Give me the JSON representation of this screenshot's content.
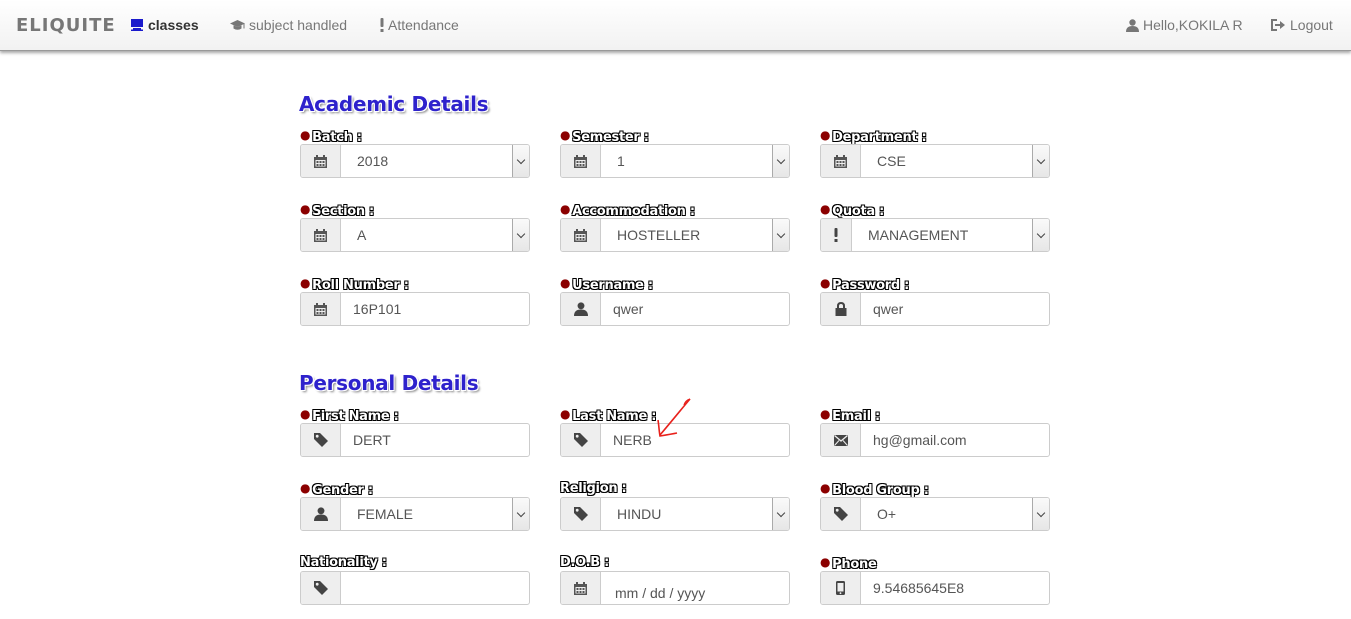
{
  "nav": {
    "brand": "ELIQUITE",
    "items": [
      {
        "label": "classes",
        "icon": "monitor-icon",
        "active": true
      },
      {
        "label": "subject handled",
        "icon": "graduation-cap-icon",
        "active": false
      },
      {
        "label": "Attendance",
        "icon": "exclamation-icon",
        "active": false
      }
    ],
    "user": "Hello,KOKILA R",
    "logout": "Logout"
  },
  "academic": {
    "title": "Academic Details",
    "batch": {
      "label": "Batch :",
      "value": "2018",
      "icon": "calendar-icon"
    },
    "semester": {
      "label": "Semester :",
      "value": "1",
      "icon": "calendar-icon"
    },
    "department": {
      "label": "Department :",
      "value": "CSE",
      "icon": "calendar-icon"
    },
    "section": {
      "label": "Section :",
      "value": "A",
      "icon": "calendar-icon"
    },
    "accommodation": {
      "label": "Accommodation :",
      "value": "HOSTELLER",
      "icon": "calendar-icon"
    },
    "quota": {
      "label": "Quota :",
      "value": "MANAGEMENT",
      "icon": "exclamation-icon"
    },
    "roll_number": {
      "label": "Roll Number :",
      "value": "16P101",
      "icon": "calendar-icon"
    },
    "username": {
      "label": "Username :",
      "value": "qwer",
      "icon": "user-icon"
    },
    "password": {
      "label": "Password :",
      "value": "qwer",
      "icon": "lock-icon"
    }
  },
  "personal": {
    "title": "Personal Details",
    "first_name": {
      "label": "First Name :",
      "value": "DERT",
      "icon": "tag-icon"
    },
    "last_name": {
      "label": "Last Name :",
      "value": "NERB",
      "icon": "tag-icon"
    },
    "email": {
      "label": "Email :",
      "value": "hg@gmail.com",
      "icon": "envelope-icon"
    },
    "gender": {
      "label": "Gender :",
      "value": "FEMALE",
      "icon": "user-icon"
    },
    "religion": {
      "label": "Religion :",
      "value": "HINDU",
      "icon": "tag-icon"
    },
    "blood_group": {
      "label": "Blood Group :",
      "value": "O+",
      "icon": "tag-icon"
    },
    "nationality": {
      "label": "Nationality :",
      "value": "",
      "icon": "tag-icon"
    },
    "dob": {
      "label": "D.O.B :",
      "value": "mm / dd / yyyy",
      "icon": "calendar-icon"
    },
    "phone": {
      "label": "Phone",
      "value": "9.54685645E8",
      "icon": "mobile-icon"
    }
  },
  "colors": {
    "heading": "#2e22cc",
    "required": "#8b0000",
    "annotation": "#e8211c"
  }
}
